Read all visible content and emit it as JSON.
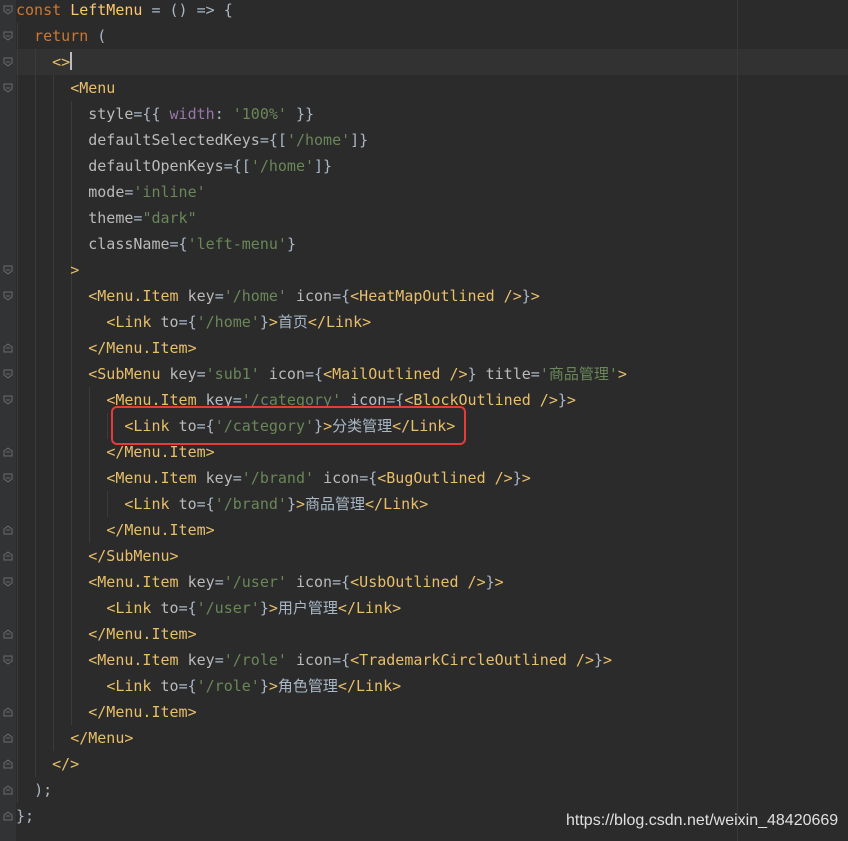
{
  "editor": {
    "language": "jsx",
    "theme": "darcula",
    "caret_line": 3,
    "lines": [
      [
        [
          "kw",
          "const "
        ],
        [
          "fn",
          "LeftMenu"
        ],
        [
          "pn",
          " = () => {"
        ]
      ],
      [
        [
          "pn",
          "  "
        ],
        [
          "kw",
          "return"
        ],
        [
          "pn",
          " ("
        ]
      ],
      [
        [
          "pn",
          "    "
        ],
        [
          "tag",
          "<>"
        ]
      ],
      [
        [
          "pn",
          "      "
        ],
        [
          "tag",
          "<Menu"
        ]
      ],
      [
        [
          "pn",
          "        "
        ],
        [
          "attr",
          "style"
        ],
        [
          "pn",
          "={{ "
        ],
        [
          "prop",
          "width"
        ],
        [
          "pn",
          ": "
        ],
        [
          "str",
          "'100%'"
        ],
        [
          "pn",
          " }}"
        ]
      ],
      [
        [
          "pn",
          "        "
        ],
        [
          "attr",
          "defaultSelectedKeys"
        ],
        [
          "pn",
          "={["
        ],
        [
          "str",
          "'/home'"
        ],
        [
          "pn",
          "]}"
        ]
      ],
      [
        [
          "pn",
          "        "
        ],
        [
          "attr",
          "defaultOpenKeys"
        ],
        [
          "pn",
          "={["
        ],
        [
          "str",
          "'/home'"
        ],
        [
          "pn",
          "]}"
        ]
      ],
      [
        [
          "pn",
          "        "
        ],
        [
          "attr",
          "mode"
        ],
        [
          "pn",
          "="
        ],
        [
          "str",
          "'inline'"
        ]
      ],
      [
        [
          "pn",
          "        "
        ],
        [
          "attr",
          "theme"
        ],
        [
          "pn",
          "="
        ],
        [
          "str",
          "\"dark\""
        ]
      ],
      [
        [
          "pn",
          "        "
        ],
        [
          "attr",
          "className"
        ],
        [
          "pn",
          "={"
        ],
        [
          "str",
          "'left-menu'"
        ],
        [
          "pn",
          "}"
        ]
      ],
      [
        [
          "pn",
          "      "
        ],
        [
          "tag",
          ">"
        ]
      ],
      [
        [
          "pn",
          "        "
        ],
        [
          "tag",
          "<Menu.Item "
        ],
        [
          "attr",
          "key"
        ],
        [
          "pn",
          "="
        ],
        [
          "str",
          "'/home'"
        ],
        [
          "pn",
          " "
        ],
        [
          "attr",
          "icon"
        ],
        [
          "pn",
          "={"
        ],
        [
          "tag",
          "<HeatMapOutlined />"
        ],
        [
          "pn",
          "}"
        ],
        [
          "tag",
          ">"
        ]
      ],
      [
        [
          "pn",
          "          "
        ],
        [
          "tag",
          "<Link "
        ],
        [
          "attr",
          "to"
        ],
        [
          "pn",
          "={"
        ],
        [
          "str",
          "'/home'"
        ],
        [
          "pn",
          "}"
        ],
        [
          "tag",
          ">"
        ],
        [
          "txt",
          "首页"
        ],
        [
          "tag",
          "</Link>"
        ]
      ],
      [
        [
          "pn",
          "        "
        ],
        [
          "tag",
          "</Menu.Item>"
        ]
      ],
      [
        [
          "pn",
          "        "
        ],
        [
          "tag",
          "<SubMenu "
        ],
        [
          "attr",
          "key"
        ],
        [
          "pn",
          "="
        ],
        [
          "str",
          "'sub1'"
        ],
        [
          "pn",
          " "
        ],
        [
          "attr",
          "icon"
        ],
        [
          "pn",
          "={"
        ],
        [
          "tag",
          "<MailOutlined />"
        ],
        [
          "pn",
          "} "
        ],
        [
          "attr",
          "title"
        ],
        [
          "pn",
          "="
        ],
        [
          "str",
          "'商品管理'"
        ],
        [
          "tag",
          ">"
        ]
      ],
      [
        [
          "pn",
          "          "
        ],
        [
          "tag",
          "<Menu.Item "
        ],
        [
          "attr",
          "key"
        ],
        [
          "pn",
          "="
        ],
        [
          "str",
          "'/category'"
        ],
        [
          "pn",
          " "
        ],
        [
          "attr",
          "icon"
        ],
        [
          "pn",
          "={"
        ],
        [
          "tag",
          "<BlockOutlined />"
        ],
        [
          "pn",
          "}"
        ],
        [
          "tag",
          ">"
        ]
      ],
      [
        [
          "pn",
          "            "
        ],
        [
          "tag",
          "<Link "
        ],
        [
          "attr",
          "to"
        ],
        [
          "pn",
          "={"
        ],
        [
          "str",
          "'/category'"
        ],
        [
          "pn",
          "}"
        ],
        [
          "tag",
          ">"
        ],
        [
          "txt",
          "分类管理"
        ],
        [
          "tag",
          "</Link>"
        ]
      ],
      [
        [
          "pn",
          "          "
        ],
        [
          "tag",
          "</Menu.Item>"
        ]
      ],
      [
        [
          "pn",
          "          "
        ],
        [
          "tag",
          "<Menu.Item "
        ],
        [
          "attr",
          "key"
        ],
        [
          "pn",
          "="
        ],
        [
          "str",
          "'/brand'"
        ],
        [
          "pn",
          " "
        ],
        [
          "attr",
          "icon"
        ],
        [
          "pn",
          "={"
        ],
        [
          "tag",
          "<BugOutlined />"
        ],
        [
          "pn",
          "}"
        ],
        [
          "tag",
          ">"
        ]
      ],
      [
        [
          "pn",
          "            "
        ],
        [
          "tag",
          "<Link "
        ],
        [
          "attr",
          "to"
        ],
        [
          "pn",
          "={"
        ],
        [
          "str",
          "'/brand'"
        ],
        [
          "pn",
          "}"
        ],
        [
          "tag",
          ">"
        ],
        [
          "txt",
          "商品管理"
        ],
        [
          "tag",
          "</Link>"
        ]
      ],
      [
        [
          "pn",
          "          "
        ],
        [
          "tag",
          "</Menu.Item>"
        ]
      ],
      [
        [
          "pn",
          "        "
        ],
        [
          "tag",
          "</SubMenu>"
        ]
      ],
      [
        [
          "pn",
          "        "
        ],
        [
          "tag",
          "<Menu.Item "
        ],
        [
          "attr",
          "key"
        ],
        [
          "pn",
          "="
        ],
        [
          "str",
          "'/user'"
        ],
        [
          "pn",
          " "
        ],
        [
          "attr",
          "icon"
        ],
        [
          "pn",
          "={"
        ],
        [
          "tag",
          "<UsbOutlined />"
        ],
        [
          "pn",
          "}"
        ],
        [
          "tag",
          ">"
        ]
      ],
      [
        [
          "pn",
          "          "
        ],
        [
          "tag",
          "<Link "
        ],
        [
          "attr",
          "to"
        ],
        [
          "pn",
          "={"
        ],
        [
          "str",
          "'/user'"
        ],
        [
          "pn",
          "}"
        ],
        [
          "tag",
          ">"
        ],
        [
          "txt",
          "用户管理"
        ],
        [
          "tag",
          "</Link>"
        ]
      ],
      [
        [
          "pn",
          "        "
        ],
        [
          "tag",
          "</Menu.Item>"
        ]
      ],
      [
        [
          "pn",
          "        "
        ],
        [
          "tag",
          "<Menu.Item "
        ],
        [
          "attr",
          "key"
        ],
        [
          "pn",
          "="
        ],
        [
          "str",
          "'/role'"
        ],
        [
          "pn",
          " "
        ],
        [
          "attr",
          "icon"
        ],
        [
          "pn",
          "={"
        ],
        [
          "tag",
          "<TrademarkCircleOutlined />"
        ],
        [
          "pn",
          "}"
        ],
        [
          "tag",
          ">"
        ]
      ],
      [
        [
          "pn",
          "          "
        ],
        [
          "tag",
          "<Link "
        ],
        [
          "attr",
          "to"
        ],
        [
          "pn",
          "={"
        ],
        [
          "str",
          "'/role'"
        ],
        [
          "pn",
          "}"
        ],
        [
          "tag",
          ">"
        ],
        [
          "txt",
          "角色管理"
        ],
        [
          "tag",
          "</Link>"
        ]
      ],
      [
        [
          "pn",
          "        "
        ],
        [
          "tag",
          "</Menu.Item>"
        ]
      ],
      [
        [
          "pn",
          "      "
        ],
        [
          "tag",
          "</Menu>"
        ]
      ],
      [
        [
          "pn",
          "    "
        ],
        [
          "tag",
          "</>"
        ]
      ],
      [
        [
          "pn",
          "  "
        ],
        [
          "pn",
          ");"
        ]
      ],
      [
        [
          "pn",
          "};"
        ]
      ]
    ],
    "highlight_annotation": {
      "line": 17,
      "color": "#e53b3b"
    }
  },
  "colors": {
    "background": "#2b2b2b",
    "gutter": "#313335",
    "keyword": "#cc7832",
    "function": "#ffc66d",
    "tag": "#e8bf6a",
    "attribute": "#bababa",
    "string": "#6a8759",
    "property": "#9876aa",
    "text": "#a9b7c6"
  },
  "watermark": {
    "text": "https://blog.csdn.net/weixin_48420669"
  }
}
